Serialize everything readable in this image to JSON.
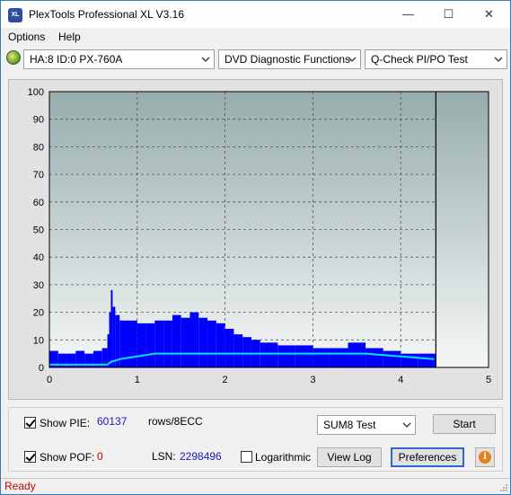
{
  "window": {
    "title": "PlexTools Professional XL V3.16",
    "icon_text": "XL",
    "minimize": "—",
    "maximize": "☐",
    "close": "✕"
  },
  "menu": {
    "items": [
      "Options",
      "Help"
    ]
  },
  "toolbar": {
    "drive": "HA:8 ID:0  PX-760A",
    "function": "DVD Diagnostic Functions",
    "test": "Q-Check PI/PO Test"
  },
  "chart_data": {
    "type": "area",
    "title": "",
    "xlabel": "",
    "ylabel": "",
    "xlim": [
      0,
      5
    ],
    "ylim": [
      0,
      100
    ],
    "x_ticks": [
      "0",
      "1",
      "2",
      "3",
      "4",
      "5"
    ],
    "y_ticks": [
      "0",
      "10",
      "20",
      "30",
      "40",
      "50",
      "60",
      "70",
      "80",
      "90",
      "100"
    ],
    "grid": true,
    "end_marker_x": 4.4,
    "series": [
      {
        "color": "#0000ff",
        "style": "bars",
        "x": [
          0.0,
          0.1,
          0.2,
          0.3,
          0.4,
          0.5,
          0.6,
          0.66,
          0.68,
          0.7,
          0.72,
          0.75,
          0.8,
          0.9,
          1.0,
          1.1,
          1.2,
          1.3,
          1.4,
          1.5,
          1.6,
          1.7,
          1.8,
          1.9,
          2.0,
          2.1,
          2.2,
          2.3,
          2.4,
          2.5,
          2.6,
          2.8,
          3.0,
          3.2,
          3.4,
          3.6,
          3.8,
          4.0,
          4.2,
          4.38
        ],
        "values": [
          6,
          5,
          5,
          6,
          5,
          6,
          7,
          12,
          20,
          28,
          22,
          19,
          17,
          17,
          16,
          16,
          17,
          17,
          19,
          18,
          20,
          18,
          17,
          16,
          14,
          12,
          11,
          10,
          9,
          9,
          8,
          8,
          7,
          7,
          9,
          7,
          6,
          5,
          5,
          5
        ]
      },
      {
        "color": "#00e5ff",
        "style": "line",
        "x": [
          0.0,
          0.2,
          0.4,
          0.6,
          0.66,
          0.7,
          0.8,
          1.0,
          1.2,
          1.4,
          1.6,
          1.8,
          2.0,
          2.4,
          2.8,
          3.2,
          3.6,
          4.0,
          4.38
        ],
        "values": [
          1,
          1,
          1,
          1,
          1,
          2,
          3,
          4,
          5,
          5,
          5,
          5,
          5,
          5,
          5,
          5,
          5,
          4,
          3
        ]
      }
    ]
  },
  "controls": {
    "show_pie_label": "Show PIE:",
    "pie_value": "60137",
    "pie_unit": "rows/8ECC",
    "show_pof_label": "Show POF:",
    "pof_value": "0",
    "lsn_label": "LSN:",
    "lsn_value": "2298496",
    "log_label": "Logarithmic",
    "sum_select": "SUM8 Test",
    "start": "Start",
    "view_log": "View Log",
    "preferences": "Preferences"
  },
  "status": {
    "text": "Ready"
  }
}
